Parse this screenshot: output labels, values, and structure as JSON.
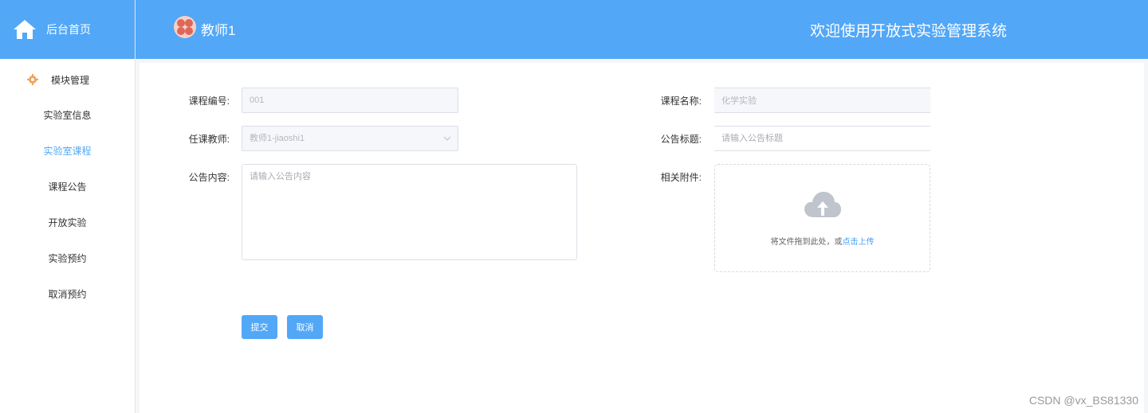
{
  "sidebar": {
    "brand_label": "后台首页",
    "group_label": "模块管理",
    "items": [
      {
        "label": "实验室信息",
        "active": false
      },
      {
        "label": "实验室课程",
        "active": true
      },
      {
        "label": "课程公告",
        "active": false
      },
      {
        "label": "开放实验",
        "active": false
      },
      {
        "label": "实验预约",
        "active": false
      },
      {
        "label": "取消预约",
        "active": false
      }
    ]
  },
  "header": {
    "username": "教师1",
    "welcome": "欢迎使用开放式实验管理系统"
  },
  "form": {
    "course_no_label": "课程编号:",
    "course_no_value": "001",
    "course_name_label": "课程名称:",
    "course_name_value": "化学实验",
    "teacher_label": "任课教师:",
    "teacher_value": "教师1-jiaoshi1",
    "title_label": "公告标题:",
    "title_placeholder": "请输入公告标题",
    "content_label": "公告内容:",
    "content_placeholder": "请输入公告内容",
    "attachment_label": "相关附件:",
    "upload_hint_prefix": "将文件拖到此处，或",
    "upload_hint_link": "点击上传",
    "submit_label": "提交",
    "cancel_label": "取消"
  },
  "watermark": "CSDN @vx_BS81330",
  "colors": {
    "primary": "#52a7f7",
    "link": "#409eff"
  }
}
